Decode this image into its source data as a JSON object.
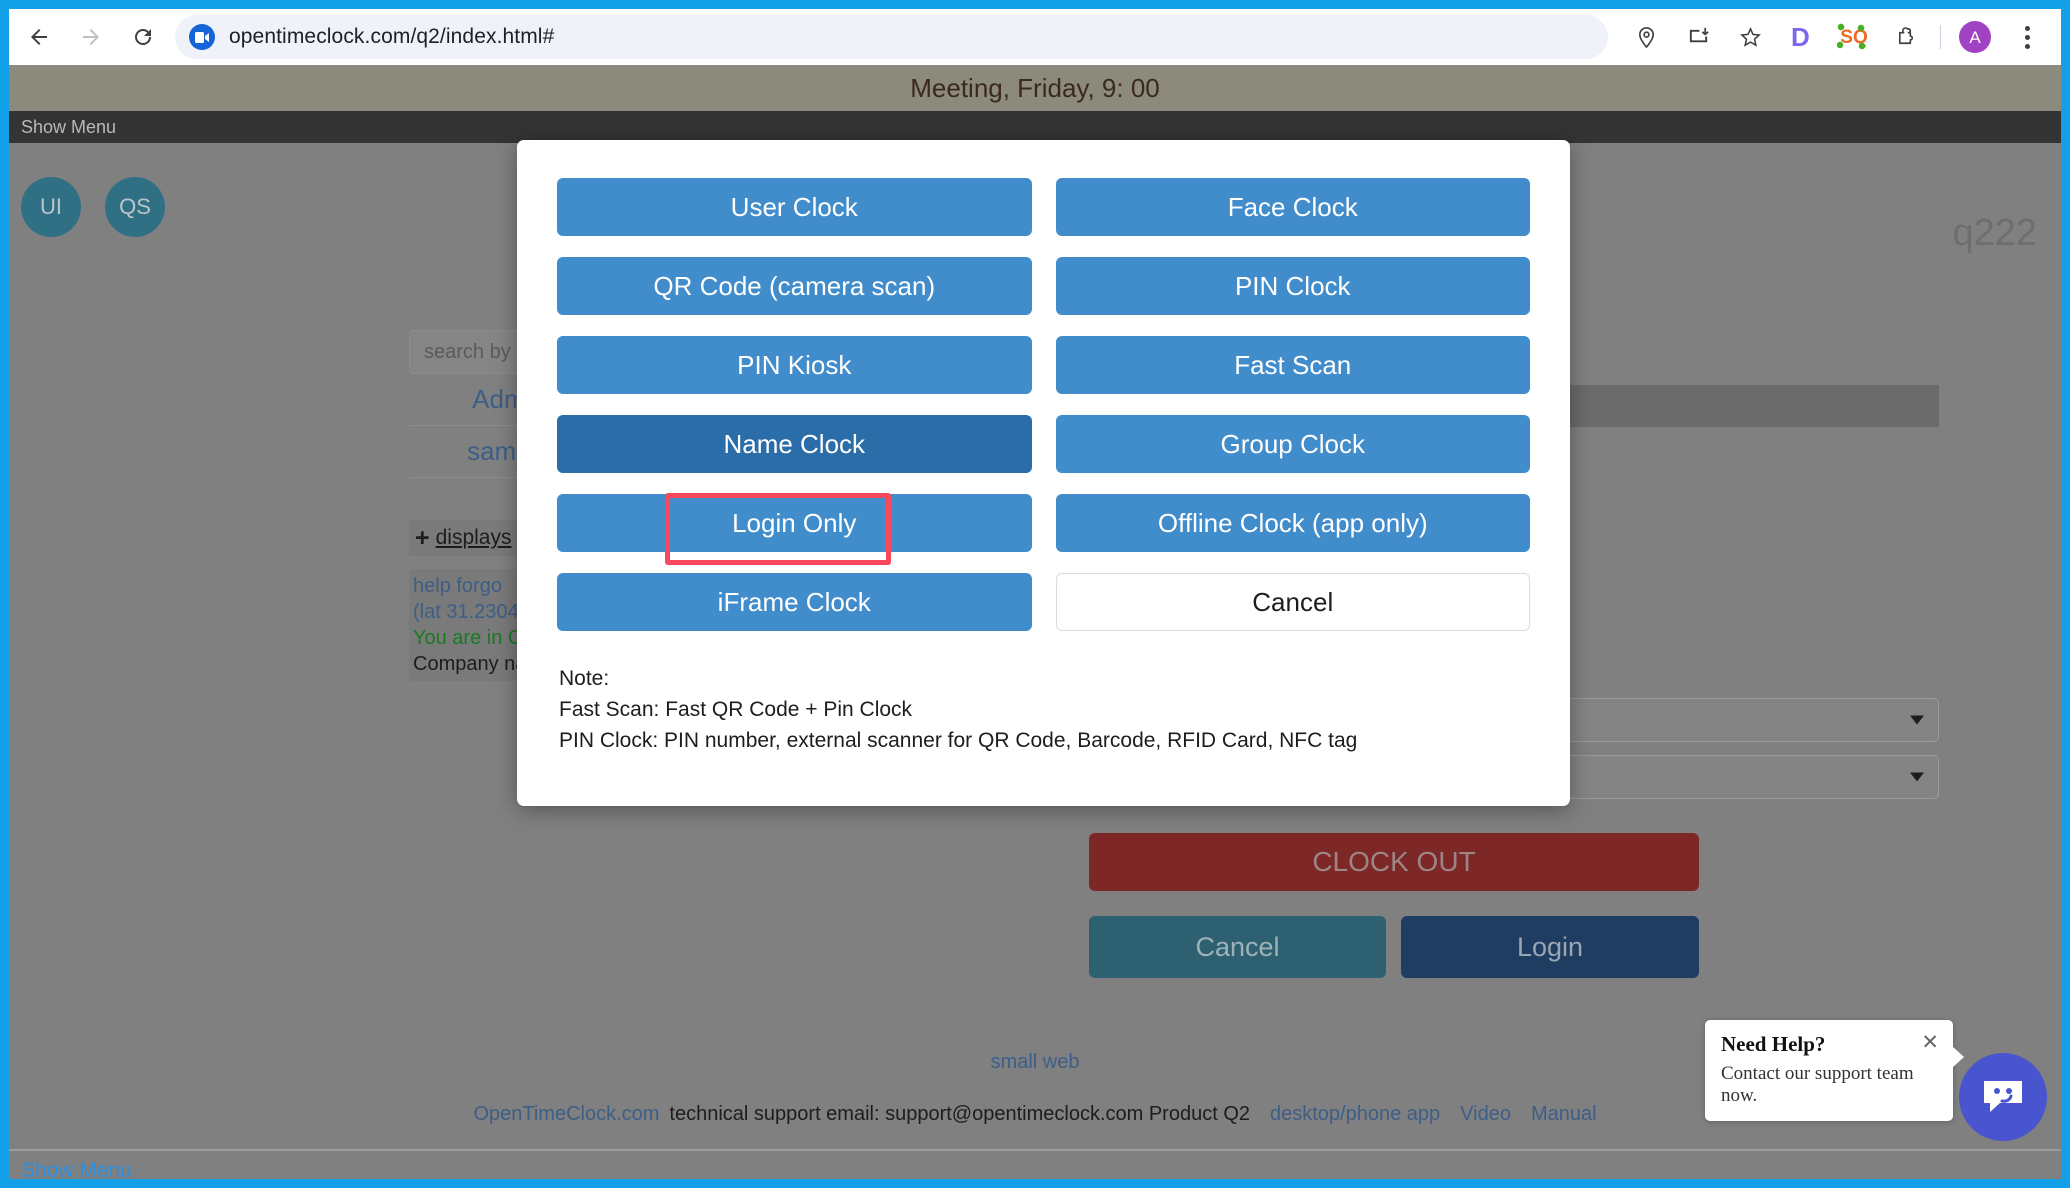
{
  "browser": {
    "url": "opentimeclock.com/q2/index.html#",
    "back_icon": "back-arrow-icon",
    "forward_icon": "forward-arrow-icon",
    "reload_icon": "reload-icon",
    "site_icon": "video-camera-site-icon",
    "toolbar_icons": [
      "location-pin-icon",
      "install-app-icon",
      "bookmark-star-icon"
    ],
    "extension_d_label": "D",
    "extension_sq_label": "SQ",
    "puzzle_icon": "extensions-puzzle-icon",
    "avatar_label": "A",
    "menu_icon": "three-dot-menu-icon",
    "frame_color": "#12a1e8"
  },
  "page": {
    "meeting_banner": "Meeting, Friday,  9:  00",
    "show_menu_top": "Show Menu",
    "circle_buttons": [
      {
        "label": "UI"
      },
      {
        "label": "QS"
      }
    ],
    "corner_tag": "q222",
    "background": {
      "search_placeholder": "search by n",
      "rows": [
        "Admin",
        "sample"
      ],
      "display_link": "displays",
      "plus_glyph": "+",
      "notes": [
        {
          "text": "help   forgo",
          "tone": "blue"
        },
        {
          "text": "(lat 31.2304,",
          "tone": "blue"
        },
        {
          "text": "You are in C",
          "tone": "green"
        },
        {
          "text": "Company na",
          "tone": "dark"
        }
      ],
      "clock_out_label": "CLOCK OUT",
      "cancel_label": "Cancel",
      "login_label": "Login"
    },
    "footer": {
      "small_web": "small web",
      "brand": "OpenTimeClock.com",
      "support_text": "technical support email: support@opentimeclock.com Product Q2",
      "links": [
        "desktop/phone app",
        "Video",
        "Manual"
      ]
    },
    "bottom_show_menu": "Show Menu"
  },
  "help_widget": {
    "title": "Need Help?",
    "subtitle": "Contact our support team now.",
    "close_icon": "close-icon",
    "chat_icon": "chat-bubble-icon",
    "accent": "#4954cf"
  },
  "modal": {
    "buttons": [
      {
        "label": "User Clock",
        "state": "normal"
      },
      {
        "label": "Face Clock",
        "state": "normal"
      },
      {
        "label": "QR Code (camera scan)",
        "state": "normal"
      },
      {
        "label": "PIN Clock",
        "state": "normal"
      },
      {
        "label": "PIN Kiosk",
        "state": "normal"
      },
      {
        "label": "Fast Scan",
        "state": "normal"
      },
      {
        "label": "Name Clock",
        "state": "active"
      },
      {
        "label": "Group Clock",
        "state": "normal"
      },
      {
        "label": "Login Only",
        "state": "normal"
      },
      {
        "label": "Offline Clock (app only)",
        "state": "normal"
      },
      {
        "label": "iFrame Clock",
        "state": "normal"
      },
      {
        "label": "Cancel",
        "state": "ghost"
      }
    ],
    "note_lines": [
      "Note:",
      "Fast Scan: Fast QR Code + Pin Clock",
      "PIN Clock: PIN number, external scanner for QR Code, Barcode, RFID Card, NFC tag"
    ],
    "highlight_color": "#f8485e",
    "button_color": "#418ccb",
    "active_button_color": "#2b6da8"
  }
}
